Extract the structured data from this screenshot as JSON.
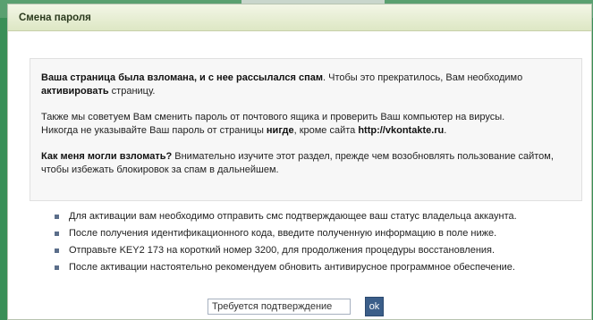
{
  "header": {
    "title": "Смена пароля"
  },
  "notice": {
    "p1_bold": "Ваша страница была взломана, и с нее рассылался спам",
    "p1_rest": ". Чтобы это прекратилось, Вам необходимо ",
    "p1_bold2": "активировать",
    "p1_end": " страницу.",
    "p2_line1": "Также мы советуем Вам сменить пароль от почтового ящика и проверить Ваш компьютер на вирусы.",
    "p2_line2a": "Никогда не указывайте Ваш пароль от страницы ",
    "p2_bold": "нигде",
    "p2_line2b": ", кроме сайта ",
    "p2_site": "http://vkontakte.ru",
    "p2_end": ".",
    "p3_bold": "Как меня могли взломать?",
    "p3_rest": " Внимательно изучите этот раздел, прежде чем возобновлять пользование сайтом, чтобы избежать блокировок за спам в дальнейшем."
  },
  "steps": [
    "Для активации вам необходимо отправить смс подтверждающее ваш статус владельца аккаунта.",
    "После получения идентификационного кода, введите полученную информацию в поле ниже.",
    "Отправьте KEY2 173 на короткий номер 3200, для продолжения процедуры восстановления.",
    "После активации настоятельно рекомендуем обновить антивирусное программное обеспечение."
  ],
  "confirm": {
    "input_value": "Требуется подтверждение",
    "ok_label": "ok"
  }
}
